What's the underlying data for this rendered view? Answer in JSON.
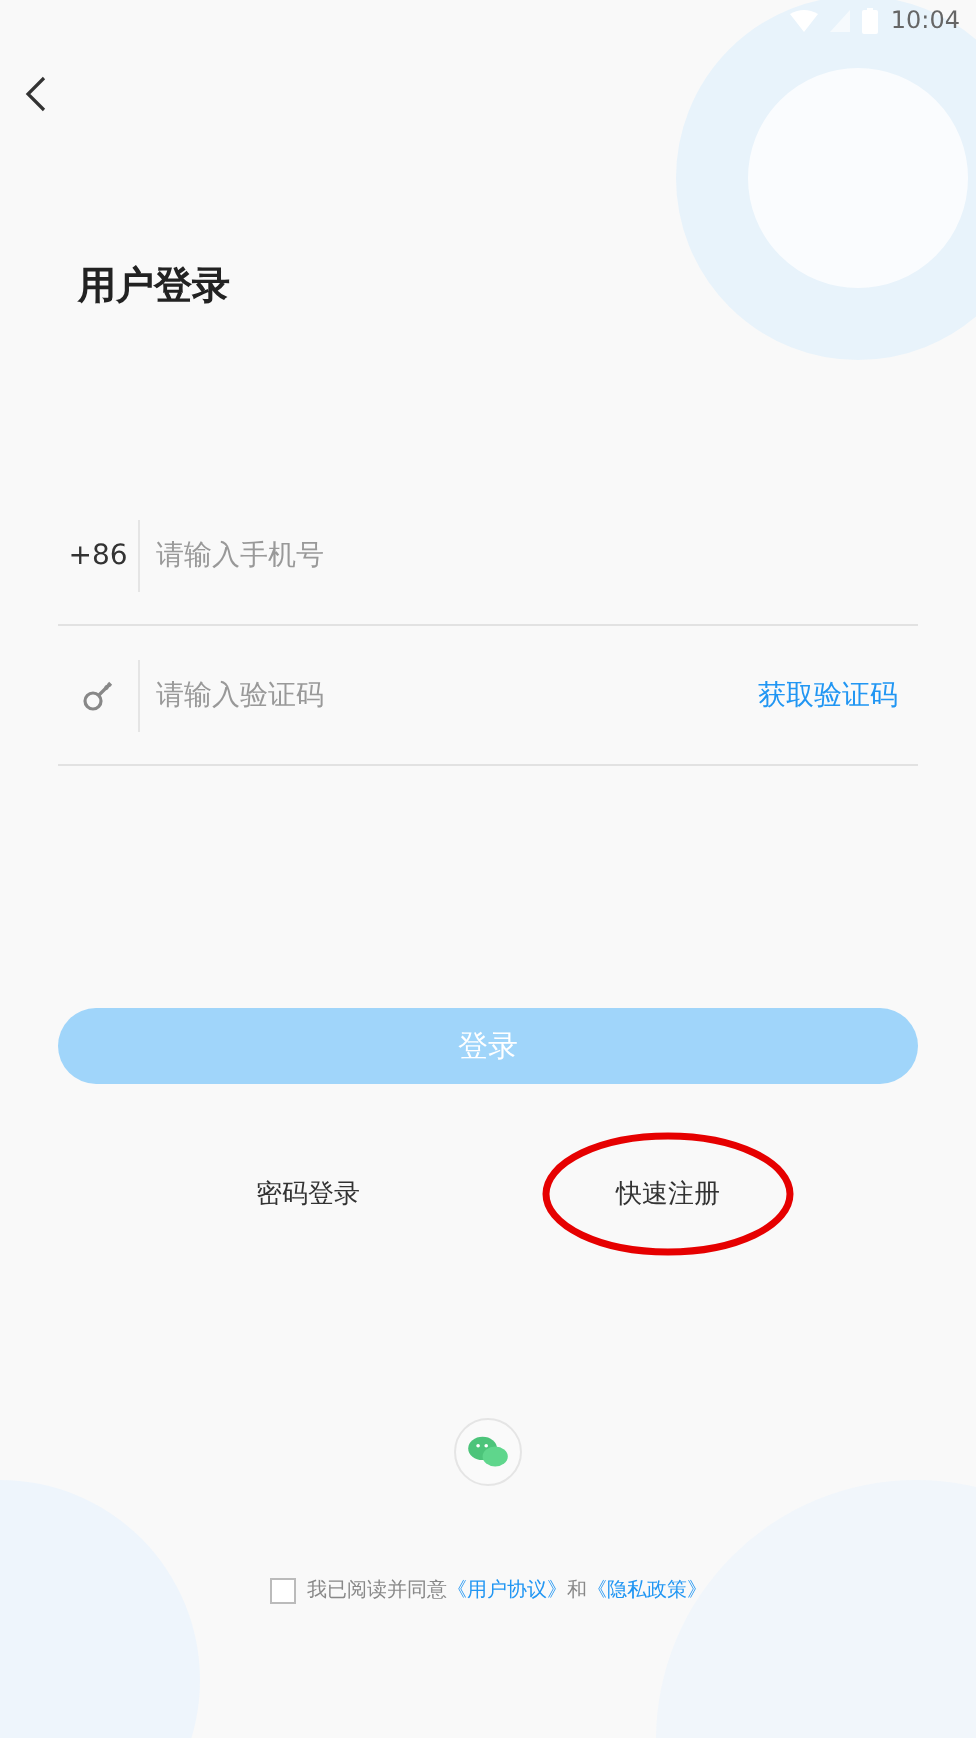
{
  "status_bar": {
    "time": "10:04"
  },
  "title": "用户登录",
  "phone_field": {
    "prefix": "+86",
    "placeholder": "请输入手机号"
  },
  "code_field": {
    "placeholder": "请输入验证码",
    "action": "获取验证码"
  },
  "login_button": {
    "label": "登录",
    "disabled": true
  },
  "links": [
    {
      "label": "密码登录",
      "circled": false
    },
    {
      "label": "快速注册",
      "circled": true
    }
  ],
  "agreement": {
    "checked": false,
    "text": "我已阅读并同意",
    "terms": "《用户协议》",
    "and": "和",
    "privacy": "《隐私政策》"
  }
}
